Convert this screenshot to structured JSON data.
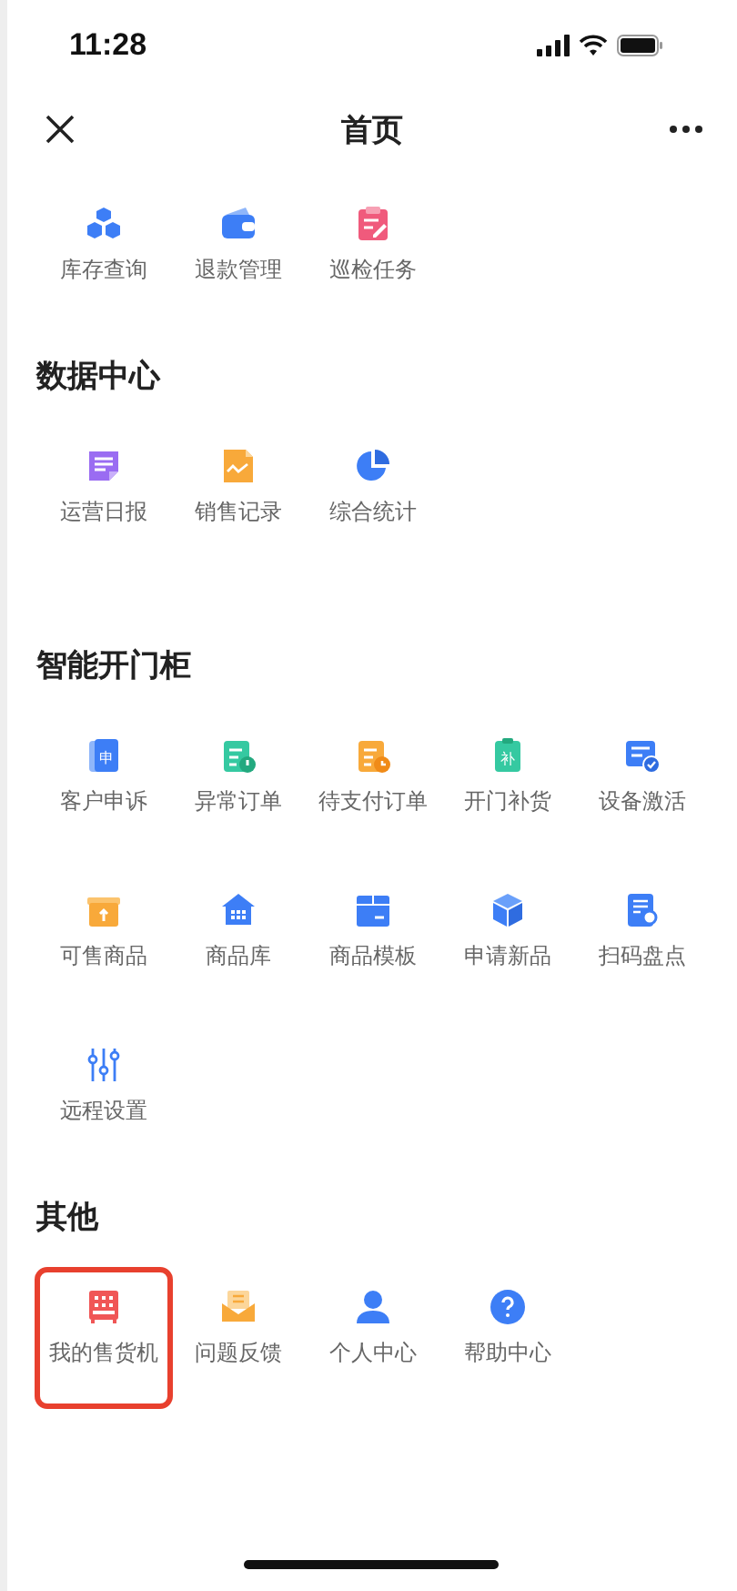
{
  "status_bar": {
    "time": "11:28"
  },
  "nav": {
    "title": "首页"
  },
  "sections": [
    {
      "items": [
        {
          "label": "库存查询",
          "highlighted": false
        },
        {
          "label": "退款管理",
          "highlighted": false
        },
        {
          "label": "巡检任务",
          "highlighted": false
        }
      ]
    },
    {
      "title": "数据中心",
      "items": [
        {
          "label": "运营日报",
          "highlighted": false
        },
        {
          "label": "销售记录",
          "highlighted": false
        },
        {
          "label": "综合统计",
          "highlighted": false
        }
      ]
    },
    {
      "title": "智能开门柜",
      "items": [
        {
          "label": "客户申诉",
          "glyph": "申",
          "highlighted": false
        },
        {
          "label": "异常订单",
          "highlighted": false
        },
        {
          "label": "待支付订单",
          "highlighted": false
        },
        {
          "label": "开门补货",
          "glyph": "补",
          "highlighted": false
        },
        {
          "label": "设备激活",
          "highlighted": false
        },
        {
          "label": "可售商品",
          "highlighted": false
        },
        {
          "label": "商品库",
          "highlighted": false
        },
        {
          "label": "商品模板",
          "highlighted": false
        },
        {
          "label": "申请新品",
          "highlighted": false
        },
        {
          "label": "扫码盘点",
          "highlighted": false
        },
        {
          "label": "远程设置",
          "highlighted": false
        }
      ]
    },
    {
      "title": "其他",
      "items": [
        {
          "label": "我的售货机",
          "highlighted": true
        },
        {
          "label": "问题反馈",
          "highlighted": false
        },
        {
          "label": "个人中心",
          "highlighted": false
        },
        {
          "label": "帮助中心",
          "highlighted": false
        }
      ]
    }
  ]
}
